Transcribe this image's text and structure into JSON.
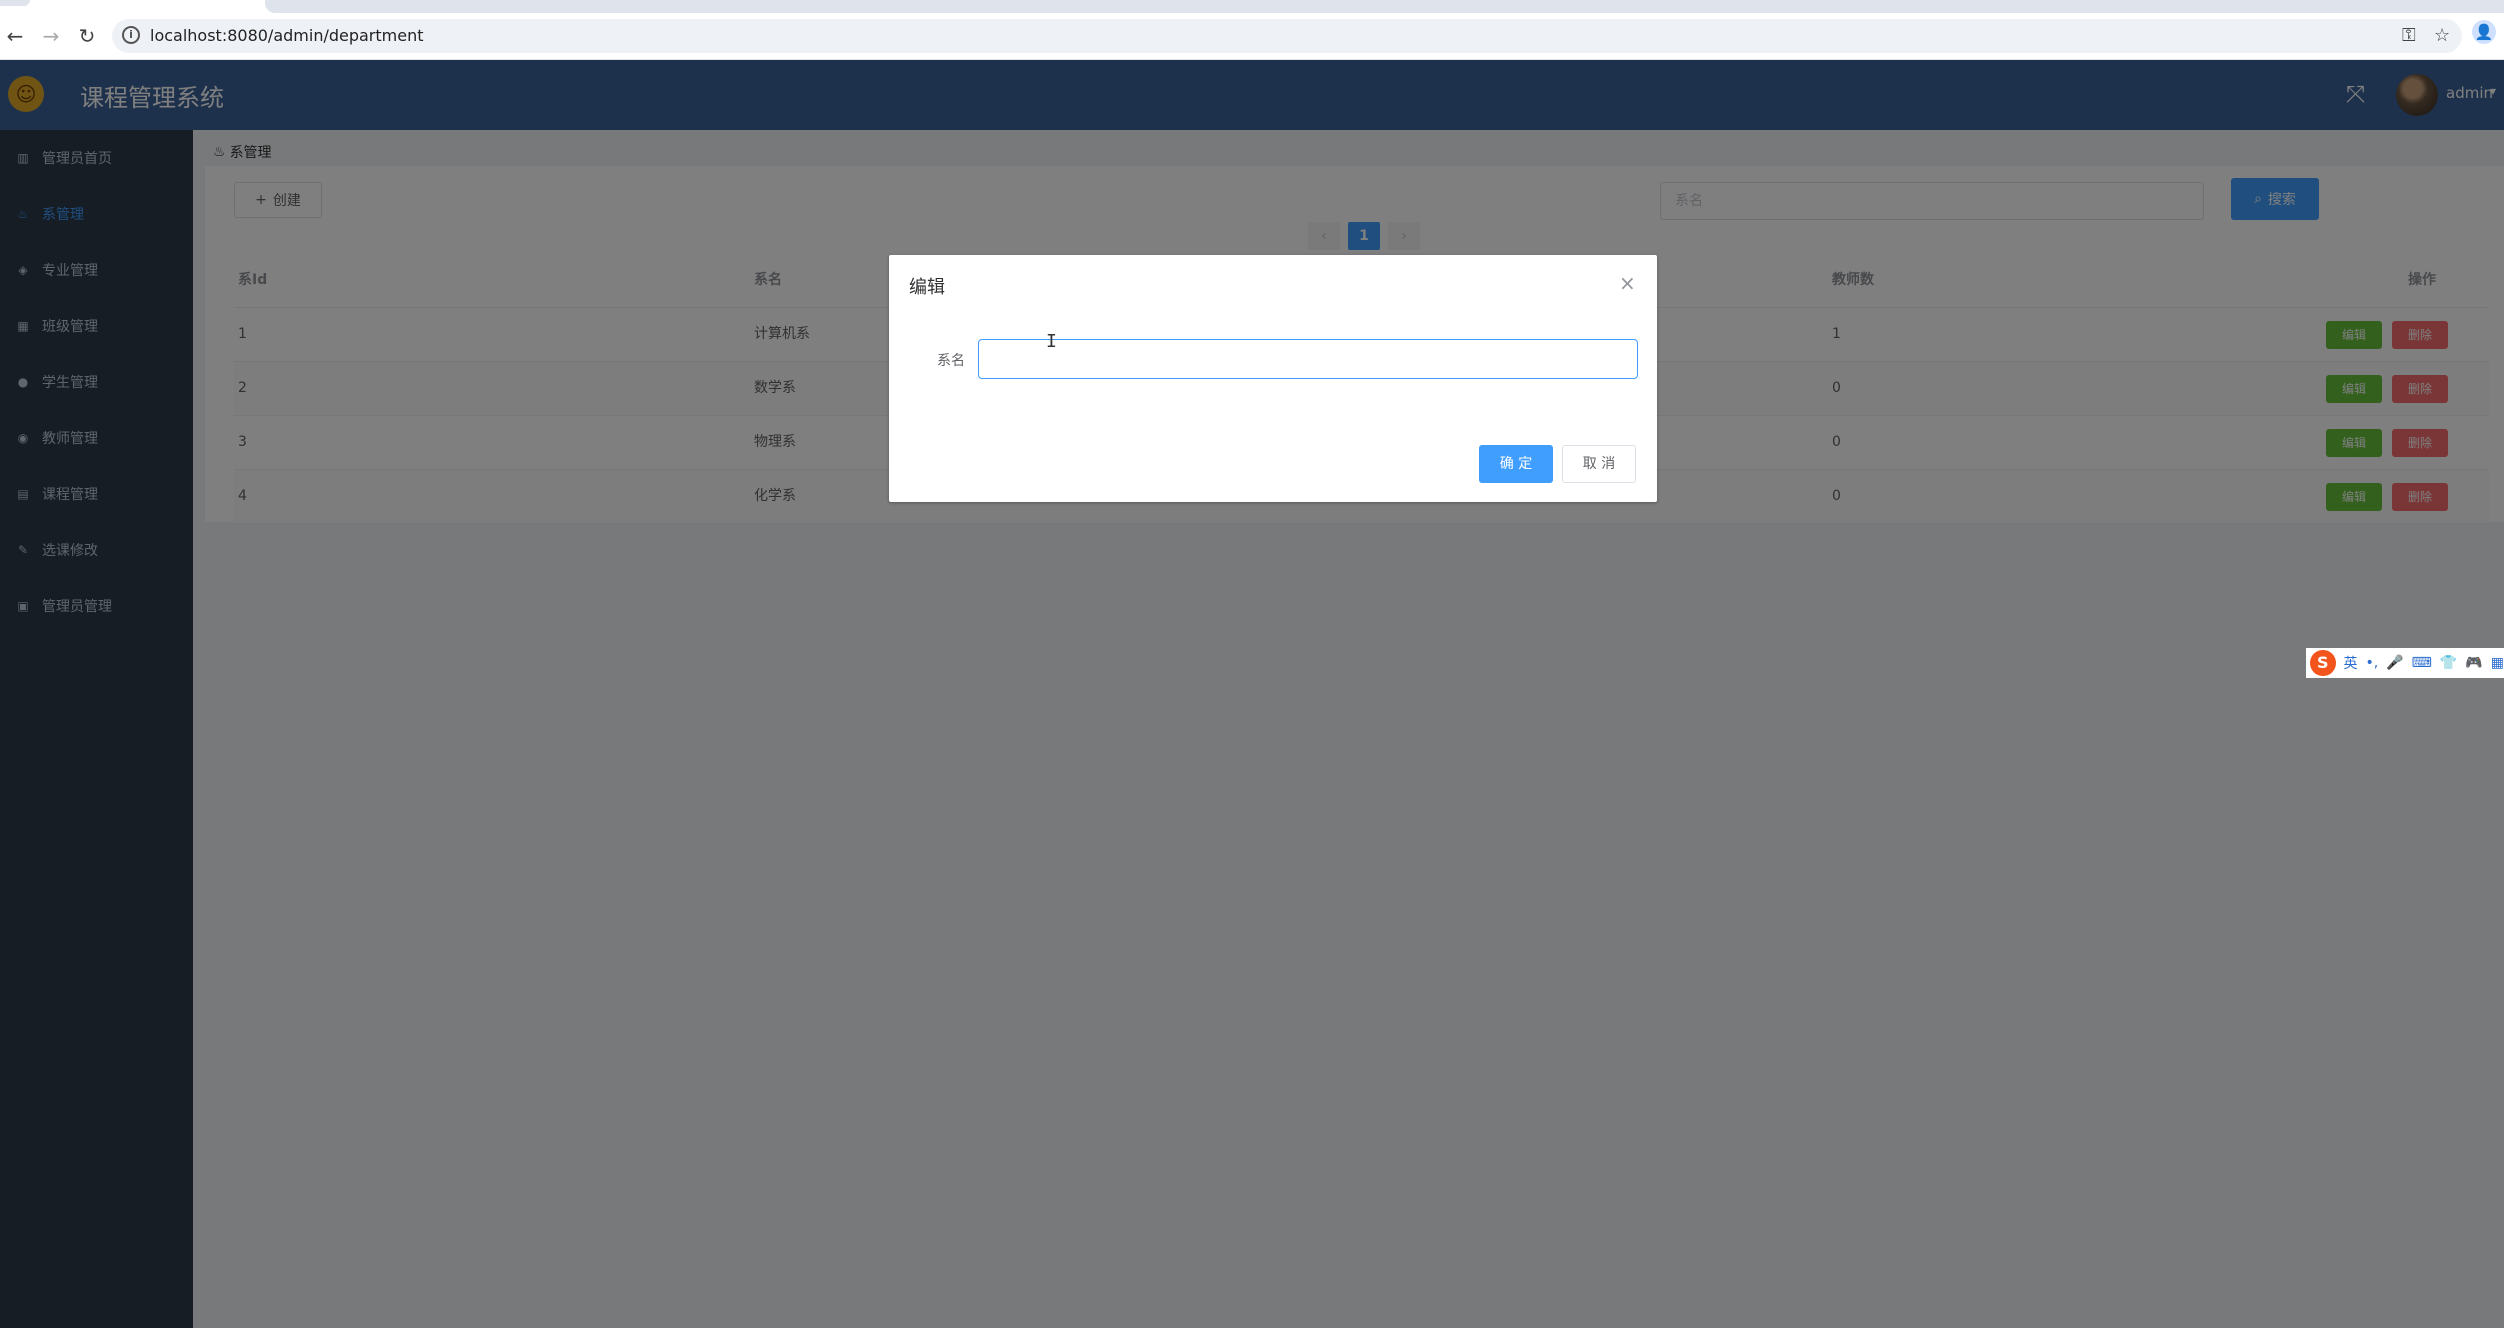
{
  "browser": {
    "url": "localhost:8080/admin/department",
    "back_glyph": "←",
    "forward_glyph": "→",
    "reload_glyph": "↻",
    "info_glyph": "i",
    "key_glyph": "⚿",
    "star_glyph": "☆",
    "profile_glyph": "👤"
  },
  "header": {
    "logo_glyph": "☺",
    "title": "课程管理系统",
    "fullscreen_glyph": "⤧",
    "user": "admin",
    "caret": "▾"
  },
  "sidebar": {
    "items": [
      {
        "label": "管理员首页",
        "icon": "chart-icon",
        "glyph": "▥"
      },
      {
        "label": "系管理",
        "icon": "fire-icon",
        "glyph": "♨"
      },
      {
        "label": "专业管理",
        "icon": "graduation-icon",
        "glyph": "◈"
      },
      {
        "label": "班级管理",
        "icon": "group-icon",
        "glyph": "▦"
      },
      {
        "label": "学生管理",
        "icon": "user-icon",
        "glyph": "●"
      },
      {
        "label": "教师管理",
        "icon": "teacher-icon",
        "glyph": "◉"
      },
      {
        "label": "课程管理",
        "icon": "book-icon",
        "glyph": "▤"
      },
      {
        "label": "选课修改",
        "icon": "edit-icon",
        "glyph": "✎"
      },
      {
        "label": "管理员管理",
        "icon": "admin-icon",
        "glyph": "▣"
      }
    ],
    "active_index": 1
  },
  "main": {
    "breadcrumb": {
      "icon_glyph": "♨",
      "label": "系管理"
    },
    "create_label": "创建",
    "create_glyph": "+",
    "search_placeholder": "系名",
    "search_label": "搜索",
    "search_glyph": "⌕",
    "pagination": {
      "prev": "‹",
      "current": "1",
      "next": "›"
    },
    "table": {
      "columns": [
        "系Id",
        "系名",
        "教师数",
        "操作"
      ],
      "rows": [
        {
          "id": "1",
          "name": "计算机系",
          "teachers": "1"
        },
        {
          "id": "2",
          "name": "数学系",
          "teachers": "0"
        },
        {
          "id": "3",
          "name": "物理系",
          "teachers": "0"
        },
        {
          "id": "4",
          "name": "化学系",
          "teachers": "0"
        }
      ],
      "edit_label": "编辑",
      "delete_label": "删除"
    }
  },
  "dialog": {
    "title": "编辑",
    "close_glyph": "×",
    "field_label": "系名",
    "field_value": "",
    "ok_label": "确 定",
    "cancel_label": "取 消",
    "cursor_glyph": "I"
  },
  "ime": {
    "logo": "S",
    "items": [
      "英",
      "•,",
      "🎤",
      "⌨",
      "👕",
      "🎮",
      "▦"
    ]
  },
  "colors": {
    "header": "#3c6398",
    "sidebar": "#2d3a4b",
    "primary": "#409eff",
    "success": "#67c23a",
    "danger": "#f56c6c"
  }
}
